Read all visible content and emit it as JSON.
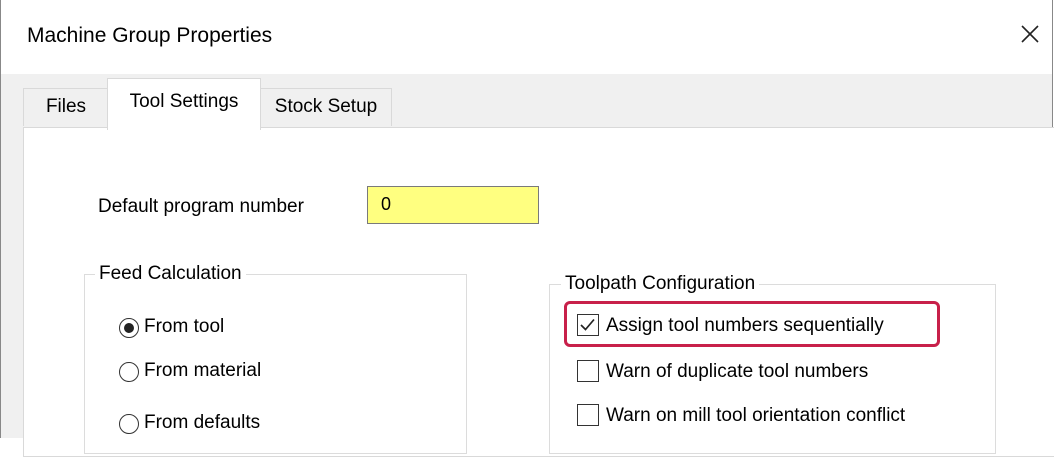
{
  "window": {
    "title": "Machine Group Properties",
    "close_icon": "close-icon"
  },
  "tabs": [
    {
      "label": "Files",
      "selected": false
    },
    {
      "label": "Tool Settings",
      "selected": true
    },
    {
      "label": "Stock Setup",
      "selected": false
    }
  ],
  "program_number": {
    "label": "Default program number",
    "value": "0"
  },
  "feed_calculation": {
    "title": "Feed Calculation",
    "options": [
      {
        "label": "From tool",
        "selected": true
      },
      {
        "label": "From material",
        "selected": false
      },
      {
        "label": "From defaults",
        "selected": false
      }
    ]
  },
  "toolpath_configuration": {
    "title": "Toolpath Configuration",
    "options": [
      {
        "label": "Assign tool numbers sequentially",
        "checked": true,
        "highlighted": true
      },
      {
        "label": "Warn of duplicate tool numbers",
        "checked": false
      },
      {
        "label": "Warn on mill tool orientation conflict",
        "checked": false
      }
    ]
  },
  "colors": {
    "highlight": "#c8204a",
    "input_background": "#ffff80"
  }
}
